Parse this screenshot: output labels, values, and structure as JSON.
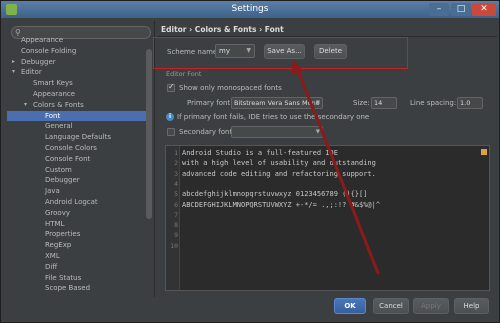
{
  "window": {
    "title": "Settings"
  },
  "search": {
    "placeholder": ""
  },
  "tree": [
    {
      "label": "Appearance",
      "indent": 1
    },
    {
      "label": "Console Folding",
      "indent": 1
    },
    {
      "label": "Debugger",
      "indent": 1,
      "arrow": "▸"
    },
    {
      "label": "Editor",
      "indent": 1,
      "arrow": "▾"
    },
    {
      "label": "Smart Keys",
      "indent": 2
    },
    {
      "label": "Appearance",
      "indent": 2
    },
    {
      "label": "Colors & Fonts",
      "indent": 2,
      "arrow": "▾"
    },
    {
      "label": "Font",
      "indent": 3,
      "selected": true
    },
    {
      "label": "General",
      "indent": 3
    },
    {
      "label": "Language Defaults",
      "indent": 3
    },
    {
      "label": "Console Colors",
      "indent": 3
    },
    {
      "label": "Console Font",
      "indent": 3
    },
    {
      "label": "Custom",
      "indent": 3
    },
    {
      "label": "Debugger",
      "indent": 3
    },
    {
      "label": "Java",
      "indent": 3
    },
    {
      "label": "Android Logcat",
      "indent": 3
    },
    {
      "label": "Groovy",
      "indent": 3
    },
    {
      "label": "HTML",
      "indent": 3
    },
    {
      "label": "Properties",
      "indent": 3
    },
    {
      "label": "RegExp",
      "indent": 3
    },
    {
      "label": "XML",
      "indent": 3
    },
    {
      "label": "Diff",
      "indent": 3
    },
    {
      "label": "File Status",
      "indent": 3
    },
    {
      "label": "Scope Based",
      "indent": 3
    }
  ],
  "main": {
    "breadcrumb": "Editor › Colors & Fonts › Font",
    "scheme_label": "Scheme name:",
    "scheme_value": "my",
    "save_as_label": "Save As...",
    "delete_label": "Delete",
    "section_title": "Editor Font",
    "mono_only_label": "Show only monospaced fonts",
    "primary_font_label": "Primary font:",
    "primary_font_value": "Bitstream Vera Sans Mono",
    "size_label": "Size:",
    "size_value": "14",
    "line_spacing_label": "Line spacing:",
    "line_spacing_value": "1.0",
    "fallback_info": "If primary font fails, IDE tries to use the secondary one",
    "secondary_font_label": "Secondary font:",
    "secondary_font_value": "",
    "preview_lines": [
      "Android Studio is a full-featured IDE",
      "with a high level of usability and outstanding",
      "advanced code editing and refactoring support.",
      "",
      "abcdefghijklmnopqrstuvwxyz 0123456789 (){}[]",
      "ABCDEFGHIJKLMNOPQRSTUVWXYZ +-*/= .,;:!? #&$%@|^",
      "",
      "",
      "",
      ""
    ],
    "line_numbers": [
      "1",
      "2",
      "3",
      "4",
      "5",
      "6",
      "7",
      "8",
      "9",
      "10"
    ]
  },
  "footer": {
    "ok": "OK",
    "cancel": "Cancel",
    "apply": "Apply",
    "help": "Help"
  },
  "colors": {
    "accent": "#4b6eaf",
    "annotation": "#c82121",
    "arrow": "#8b1a1a"
  }
}
